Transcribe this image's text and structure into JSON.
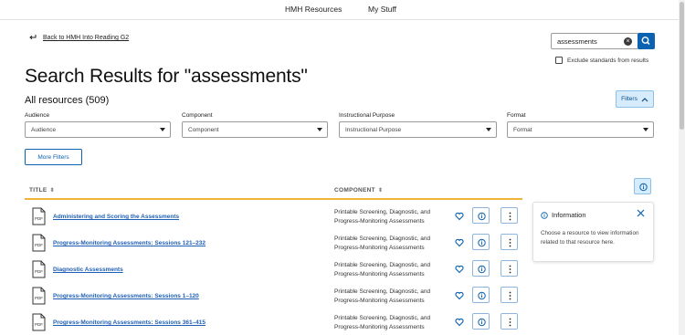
{
  "topnav": {
    "items": [
      {
        "label": "HMH Resources"
      },
      {
        "label": "My Stuff"
      }
    ]
  },
  "back_link": {
    "label": "Back to HMH Into Reading G2"
  },
  "search": {
    "value": "assessments",
    "exclude_label": "Exclude standards from results"
  },
  "page": {
    "title": "Search Results for \"assessments\"",
    "results_count": "All resources (509)",
    "filters_button": "Filters",
    "more_filters_button": "More Filters"
  },
  "filters": [
    {
      "label": "Audience",
      "selected": "Audience"
    },
    {
      "label": "Component",
      "selected": "Component"
    },
    {
      "label": "Instructional Purpose",
      "selected": "Instructional Purpose"
    },
    {
      "label": "Format",
      "selected": "Format"
    }
  ],
  "table": {
    "columns": {
      "title": "TITLE",
      "component": "COMPONENT"
    },
    "file_type": "PDF",
    "rows": [
      {
        "title": "Administering and Scoring the Assessments",
        "component_line1": "Printable Screening, Diagnostic, and",
        "component_line2": "Progress-Monitoring Assessments"
      },
      {
        "title": "Progress-Monitoring Assessments: Sessions 121–232",
        "component_line1": "Printable Screening, Diagnostic, and",
        "component_line2": "Progress-Monitoring Assessments"
      },
      {
        "title": "Diagnostic Assessments",
        "component_line1": "Printable Screening, Diagnostic, and",
        "component_line2": "Progress-Monitoring Assessments"
      },
      {
        "title": "Progress-Monitoring Assessments: Sessions 1–120",
        "component_line1": "Printable Screening, Diagnostic, and",
        "component_line2": "Progress-Monitoring Assessments"
      },
      {
        "title": "Progress-Monitoring Assessments: Sessions 361–415",
        "component_line1": "Printable Screening, Diagnostic, and",
        "component_line2": "Progress-Monitoring Assessments"
      }
    ]
  },
  "info_panel": {
    "title": "Information",
    "body": "Choose a resource to view information related to that resource here."
  },
  "colors": {
    "primary_blue": "#0b62b0",
    "link_blue": "#1e5fb5",
    "accent_orange": "#f0b43a",
    "button_light_blue": "#d6ebfb"
  },
  "icons": [
    "back-arrow-icon",
    "clear-icon",
    "search-icon",
    "chevron-up-icon",
    "caret-down-icon",
    "sort-icon",
    "pdf-icon",
    "heart-icon",
    "info-icon",
    "kebab-menu-icon",
    "close-icon"
  ]
}
